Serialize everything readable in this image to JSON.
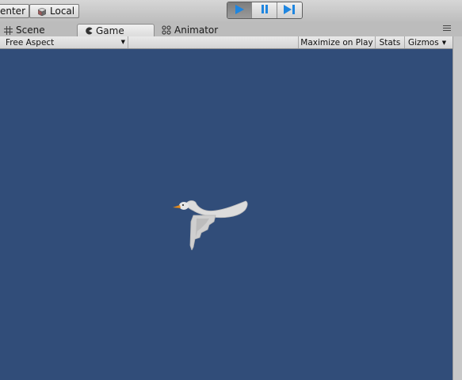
{
  "toolbar": {
    "center_label": "Center",
    "local_label": "Local",
    "play_icon": "play-icon",
    "pause_icon": "pause-icon",
    "step_icon": "step-icon",
    "accent": "#1f86e0"
  },
  "tabs": [
    {
      "label": "Scene",
      "icon": "scene-hash-icon"
    },
    {
      "label": "Game",
      "icon": "game-pacman-icon",
      "active": true
    },
    {
      "label": "Animator",
      "icon": "animator-icon"
    }
  ],
  "game_bar": {
    "aspect_value": "Free Aspect",
    "maximize_label": "Maximize on Play",
    "stats_label": "Stats",
    "gizmos_label": "Gizmos"
  },
  "viewport": {
    "background": "#314d79",
    "sprite": "swan-sprite"
  }
}
